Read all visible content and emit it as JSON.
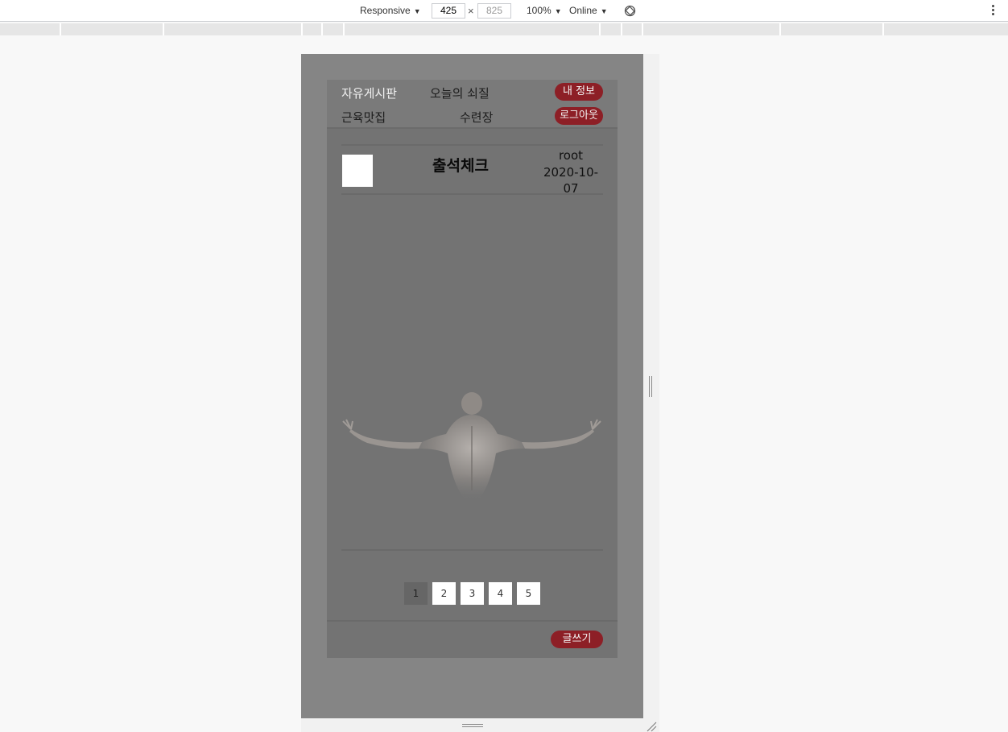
{
  "devtools": {
    "device_mode": "Responsive",
    "width_value": "425",
    "height_value": "825",
    "zoom": "100%",
    "throttle": "Online"
  },
  "nav": {
    "row1": [
      "자유게시판",
      "오늘의 쇠질"
    ],
    "row2": [
      "근육맛집",
      "수련장"
    ],
    "my_info_label": "내 정보",
    "logout_label": "로그아웃"
  },
  "post": {
    "title": "출석체크",
    "author": "root",
    "date": "2020-10-07"
  },
  "pagination": {
    "pages": [
      "1",
      "2",
      "3",
      "4",
      "5"
    ],
    "current": "1"
  },
  "footer": {
    "write_label": "글쓰기"
  },
  "colors": {
    "accent": "#8d1f26",
    "device_bg": "#858585",
    "content_bg": "#737373"
  }
}
